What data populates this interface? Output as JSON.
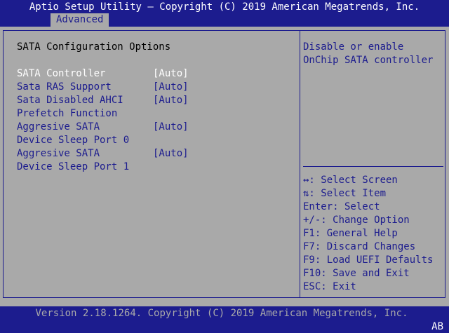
{
  "header": {
    "title": "Aptio Setup Utility – Copyright (C) 2019 American Megatrends, Inc.",
    "active_tab": "Advanced"
  },
  "main": {
    "section_title": "SATA Configuration Options",
    "options": [
      {
        "label_line1": "SATA Controller",
        "label_line2": "",
        "value": "[Auto]"
      },
      {
        "label_line1": "Sata RAS Support",
        "label_line2": "",
        "value": "[Auto]"
      },
      {
        "label_line1": "Sata Disabled AHCI",
        "label_line2": "Prefetch Function",
        "value": "[Auto]"
      },
      {
        "label_line1": "Aggresive SATA",
        "label_line2": "Device Sleep Port 0",
        "value": "[Auto]"
      },
      {
        "label_line1": "Aggresive SATA",
        "label_line2": "Device Sleep Port 1",
        "value": "[Auto]"
      }
    ]
  },
  "help": {
    "line1": "Disable or enable",
    "line2": "OnChip SATA controller"
  },
  "keys": [
    "↔: Select Screen",
    "⇅: Select Item",
    "Enter: Select",
    "+/-: Change Option",
    "F1: General Help",
    "F7: Discard Changes",
    "F9: Load UEFI Defaults",
    "F10: Save and Exit",
    "ESC: Exit"
  ],
  "footer": {
    "version": "Version 2.18.1264. Copyright (C) 2019 American Megatrends, Inc.",
    "corner": "AB"
  },
  "colors": {
    "bios_blue": "#1c1c8e",
    "bios_gray": "#a9a9a9",
    "highlight_white": "#ffffff"
  }
}
